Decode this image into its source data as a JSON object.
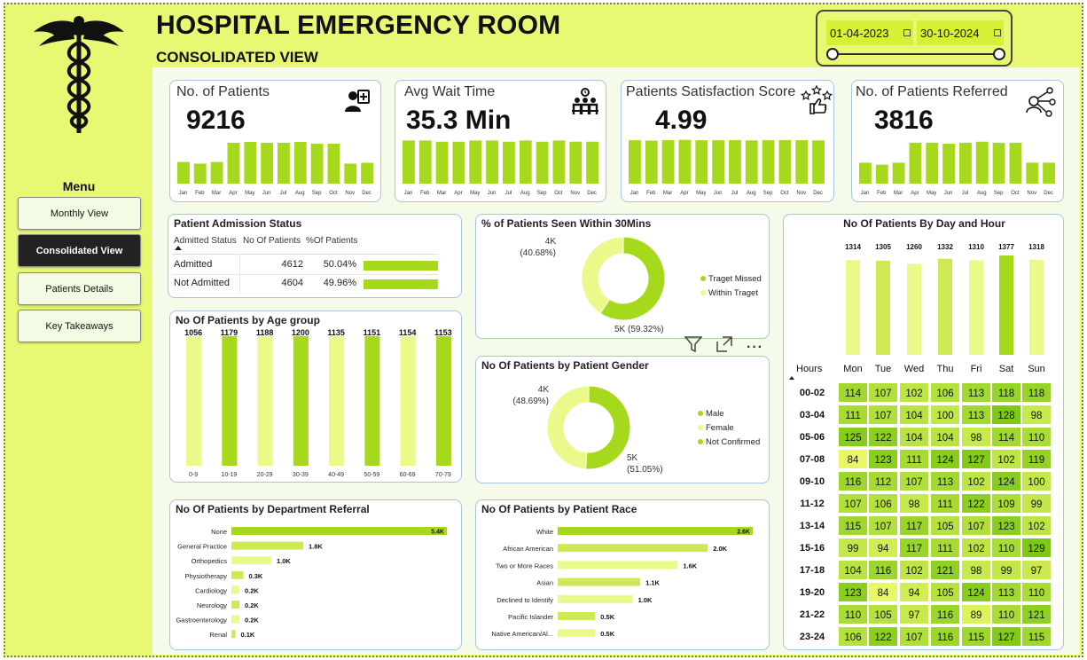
{
  "header": {
    "title": "HOSPITAL EMERGENCY ROOM",
    "subtitle": "CONSOLIDATED VIEW"
  },
  "date_range": {
    "start": "01-04-2023",
    "end": "30-10-2024"
  },
  "menu": {
    "title": "Menu",
    "items": [
      {
        "label": "Monthly View"
      },
      {
        "label": "Consolidated View",
        "active": true
      },
      {
        "label": "Patients Details"
      },
      {
        "label": "Key Takeaways"
      }
    ]
  },
  "kpis": [
    {
      "label": "No. of Patients",
      "value": "9216",
      "icon": "patient-icon"
    },
    {
      "label": "Avg Wait Time",
      "value": "35.3 Min",
      "icon": "waiting-room-icon"
    },
    {
      "label": "Patients Satisfaction Score",
      "value": "4.99",
      "icon": "rating-icon"
    },
    {
      "label": "No. of Patients Referred",
      "value": "3816",
      "icon": "referral-network-icon"
    }
  ],
  "colors": {
    "accent": "#a6d91c",
    "light": "#eaf98a",
    "mid": "#cdea55",
    "background": "#e8f872",
    "panel": "#f4fbe8",
    "dark": "#222222"
  },
  "chart_data": [
    {
      "type": "bar",
      "id": "kpi-patients",
      "categories": [
        "Jan",
        "Feb",
        "Mar",
        "Apr",
        "May",
        "Jun",
        "Jul",
        "Aug",
        "Sep",
        "Oct",
        "Nov",
        "Dec"
      ],
      "values": [
        520,
        480,
        520,
        980,
        1000,
        980,
        980,
        1000,
        960,
        960,
        480,
        500
      ],
      "ylim": [
        0,
        1150
      ]
    },
    {
      "type": "bar",
      "id": "kpi-wait",
      "categories": [
        "Jan",
        "Feb",
        "Mar",
        "Apr",
        "May",
        "Jun",
        "Jul",
        "Aug",
        "Sep",
        "Oct",
        "Nov",
        "Dec"
      ],
      "values": [
        36,
        36,
        35,
        35,
        36,
        36,
        35,
        36,
        35,
        36,
        35,
        35
      ],
      "ylim": [
        0,
        40
      ]
    },
    {
      "type": "bar",
      "id": "kpi-satisfaction",
      "categories": [
        "Jan",
        "Feb",
        "Mar",
        "Apr",
        "May",
        "Jun",
        "Jul",
        "Aug",
        "Sep",
        "Oct",
        "Nov",
        "Dec"
      ],
      "values": [
        4.98,
        4.94,
        5.0,
        5.02,
        4.98,
        4.98,
        5.0,
        4.96,
        4.98,
        5.0,
        4.98,
        4.96
      ],
      "ylim": [
        0,
        5.5
      ]
    },
    {
      "type": "bar",
      "id": "kpi-referred",
      "categories": [
        "Jan",
        "Feb",
        "Mar",
        "Apr",
        "May",
        "Jun",
        "Jul",
        "Aug",
        "Sep",
        "Oct",
        "Nov",
        "Dec"
      ],
      "values": [
        210,
        190,
        210,
        410,
        410,
        400,
        410,
        420,
        410,
        410,
        210,
        210
      ],
      "ylim": [
        0,
        480
      ]
    },
    {
      "type": "table",
      "id": "admission",
      "title": "Patient Admission Status",
      "columns": [
        "Admitted Status",
        "No Of Patients",
        "%Of Patients"
      ],
      "rows": [
        [
          "Admitted",
          "4612",
          "50.04%"
        ],
        [
          "Not Admitted",
          "4604",
          "49.96%"
        ]
      ],
      "values": [
        50.04,
        49.96
      ]
    },
    {
      "type": "bar",
      "id": "age",
      "title": "No Of Patients by Age group",
      "categories": [
        "0-9",
        "10-19",
        "20-29",
        "30-39",
        "40-49",
        "50-59",
        "60-69",
        "70-79"
      ],
      "values": [
        1056,
        1179,
        1188,
        1200,
        1135,
        1151,
        1154,
        1153
      ],
      "labels": [
        "1056",
        "1179",
        "1188",
        "1200",
        "1135",
        "1151",
        "1154",
        "1153"
      ],
      "ylim": [
        0,
        1200
      ]
    },
    {
      "type": "pie",
      "id": "seen30",
      "title": "% of Patients Seen Within 30Mins",
      "categories": [
        "Traget Missed",
        "Within Traget"
      ],
      "values": [
        59.32,
        40.68
      ],
      "labels": [
        "5K (59.32%)",
        "4K\n(40.68%)"
      ],
      "legend": "right"
    },
    {
      "type": "pie",
      "id": "gender",
      "title": "No Of Patients by Patient Gender",
      "categories": [
        "Male",
        "Female",
        "Not Confirmed"
      ],
      "values": [
        51.05,
        48.69,
        0.26
      ],
      "labels": [
        "5K\n(51.05%)",
        "4K\n(48.69%)"
      ],
      "legend": "right"
    },
    {
      "type": "bar",
      "id": "dayhour",
      "title": "No Of Patients By Day and Hour",
      "categories": [
        "Mon",
        "Tue",
        "Wed",
        "Thu",
        "Fri",
        "Sat",
        "Sun"
      ],
      "values": [
        1314,
        1305,
        1260,
        1332,
        1310,
        1377,
        1318
      ],
      "ylim": [
        0,
        1377
      ]
    },
    {
      "type": "heatmap",
      "id": "hours",
      "corner": "Hours",
      "rows": [
        "00-02",
        "03-04",
        "05-06",
        "07-08",
        "09-10",
        "11-12",
        "13-14",
        "15-16",
        "17-18",
        "19-20",
        "21-22",
        "23-24"
      ],
      "cols": [
        "Mon",
        "Tue",
        "Wed",
        "Thu",
        "Fri",
        "Sat",
        "Sun"
      ],
      "values": [
        [
          114,
          107,
          102,
          106,
          113,
          118,
          118
        ],
        [
          111,
          107,
          104,
          100,
          113,
          128,
          98
        ],
        [
          125,
          122,
          104,
          104,
          98,
          114,
          110
        ],
        [
          84,
          123,
          111,
          124,
          127,
          102,
          119
        ],
        [
          116,
          112,
          107,
          113,
          102,
          124,
          100
        ],
        [
          107,
          106,
          98,
          111,
          122,
          109,
          99
        ],
        [
          115,
          107,
          117,
          105,
          107,
          123,
          102
        ],
        [
          99,
          94,
          117,
          111,
          102,
          110,
          129
        ],
        [
          104,
          116,
          102,
          121,
          98,
          99,
          97
        ],
        [
          123,
          84,
          94,
          105,
          124,
          113,
          110
        ],
        [
          110,
          105,
          97,
          116,
          89,
          110,
          121
        ],
        [
          106,
          122,
          107,
          116,
          115,
          127,
          115
        ]
      ]
    },
    {
      "type": "bar",
      "id": "dept",
      "title": "No Of Patients by Department Referral",
      "categories": [
        "None",
        "General Practice",
        "Orthopedics",
        "Physiotherapy",
        "Cardiology",
        "Neurology",
        "Gastroenterology",
        "Renal"
      ],
      "values": [
        5.4,
        1.8,
        1.0,
        0.3,
        0.2,
        0.2,
        0.2,
        0.1
      ],
      "labels": [
        "5.4K",
        "1.8K",
        "1.0K",
        "0.3K",
        "0.2K",
        "0.2K",
        "0.2K",
        "0.1K"
      ],
      "xlim": [
        0,
        5.4
      ]
    },
    {
      "type": "bar",
      "id": "race",
      "title": "No Of Patients by Patient Race",
      "categories": [
        "White",
        "African American",
        "Two or More Races",
        "Asian",
        "Declined to Identify",
        "Pacific Islander",
        "Native American/Al..."
      ],
      "values": [
        2.6,
        2.0,
        1.6,
        1.1,
        1.0,
        0.5,
        0.5
      ],
      "labels": [
        "2.6K",
        "2.0K",
        "1.6K",
        "1.1K",
        "1.0K",
        "0.5K",
        "0.5K"
      ],
      "xlim": [
        0,
        2.6
      ]
    }
  ]
}
